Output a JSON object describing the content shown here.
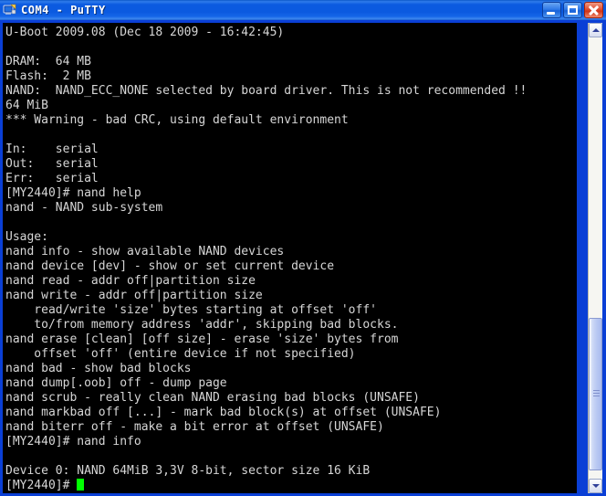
{
  "window": {
    "title": "COM4 - PuTTY",
    "icon": "putty-computer-icon",
    "accent_color": "#0b5ae0",
    "close_color": "#cf3418",
    "terminal_bg": "#000000",
    "terminal_fg": "#d6d6d6",
    "cursor_color": "#00ff00"
  },
  "titlebar_buttons": {
    "minimize_label": "Minimize",
    "maximize_label": "Maximize",
    "close_label": "Close"
  },
  "scrollbar": {
    "up_label": "Scroll up",
    "down_label": "Scroll down",
    "thumb_label": "Scroll thumb"
  },
  "terminal": {
    "prompt": "[MY2440]#",
    "cursor": "block",
    "lines": [
      "U-Boot 2009.08 (Dec 18 2009 - 16:42:45)",
      "",
      "DRAM:  64 MB",
      "Flash:  2 MB",
      "NAND:  NAND_ECC_NONE selected by board driver. This is not recommended !!",
      "64 MiB",
      "*** Warning - bad CRC, using default environment",
      "",
      "In:    serial",
      "Out:   serial",
      "Err:   serial",
      "[MY2440]# nand help",
      "nand - NAND sub-system",
      "",
      "Usage:",
      "nand info - show available NAND devices",
      "nand device [dev] - show or set current device",
      "nand read - addr off|partition size",
      "nand write - addr off|partition size",
      "    read/write 'size' bytes starting at offset 'off'",
      "    to/from memory address 'addr', skipping bad blocks.",
      "nand erase [clean] [off size] - erase 'size' bytes from",
      "    offset 'off' (entire device if not specified)",
      "nand bad - show bad blocks",
      "nand dump[.oob] off - dump page",
      "nand scrub - really clean NAND erasing bad blocks (UNSAFE)",
      "nand markbad off [...] - mark bad block(s) at offset (UNSAFE)",
      "nand biterr off - make a bit error at offset (UNSAFE)",
      "[MY2440]# nand info",
      "",
      "Device 0: NAND 64MiB 3,3V 8-bit, sector size 16 KiB"
    ],
    "last_line_prompt": "[MY2440]# "
  }
}
